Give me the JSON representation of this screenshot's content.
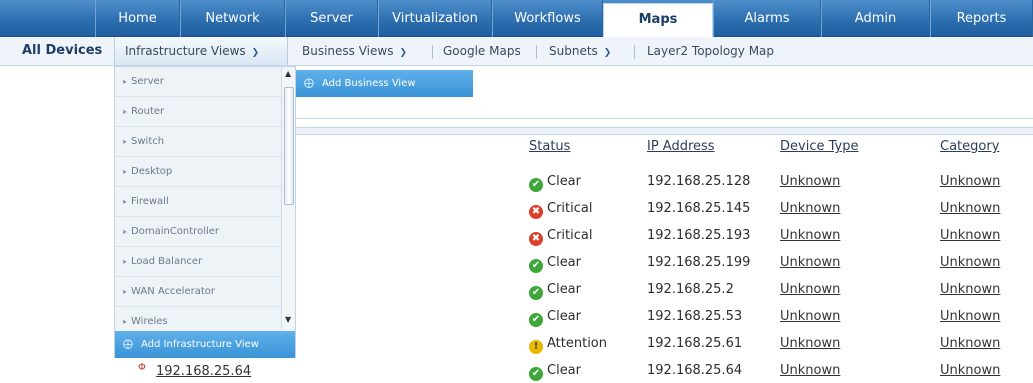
{
  "top_nav": {
    "tabs": [
      {
        "label": "Home"
      },
      {
        "label": "Network"
      },
      {
        "label": "Server"
      },
      {
        "label": "Virtualization"
      },
      {
        "label": "Workflows"
      },
      {
        "label": "Maps"
      },
      {
        "label": "Alarms"
      },
      {
        "label": "Admin"
      },
      {
        "label": "Reports"
      }
    ],
    "active": "Maps"
  },
  "sub_nav": {
    "items": [
      {
        "label": "All Devices"
      },
      {
        "label": "Infrastructure Views"
      },
      {
        "label": "Business Views"
      },
      {
        "label": "Google Maps"
      },
      {
        "label": "Subnets"
      },
      {
        "label": "Layer2 Topology Map"
      }
    ]
  },
  "infrastructure_menu": {
    "items": [
      {
        "label": "Server"
      },
      {
        "label": "Router"
      },
      {
        "label": "Switch"
      },
      {
        "label": "Desktop"
      },
      {
        "label": "Firewall"
      },
      {
        "label": "DomainController"
      },
      {
        "label": "Load Balancer"
      },
      {
        "label": "WAN Accelerator"
      },
      {
        "label": "Wireles"
      }
    ],
    "add_label": "Add Infrastructure View"
  },
  "business_menu": {
    "add_label": "Add Business View"
  },
  "table": {
    "columns": [
      "Status",
      "IP Address",
      "Device Type",
      "Category"
    ],
    "rows": [
      {
        "status": "Clear",
        "status_kind": "clear",
        "ip": "192.168.25.128",
        "device_type": "Unknown",
        "category": "Unknown"
      },
      {
        "status": "Critical",
        "status_kind": "critical",
        "ip": "192.168.25.145",
        "device_type": "Unknown",
        "category": "Unknown"
      },
      {
        "status": "Critical",
        "status_kind": "critical",
        "ip": "192.168.25.193",
        "device_type": "Unknown",
        "category": "Unknown"
      },
      {
        "status": "Clear",
        "status_kind": "clear",
        "ip": "192.168.25.199",
        "device_type": "Unknown",
        "category": "Unknown"
      },
      {
        "status": "Clear",
        "status_kind": "clear",
        "ip": "192.168.25.2",
        "device_type": "Unknown",
        "category": "Unknown"
      },
      {
        "status": "Clear",
        "status_kind": "clear",
        "ip": "192.168.25.53",
        "device_type": "Unknown",
        "category": "Unknown"
      },
      {
        "status": "Attention",
        "status_kind": "attention",
        "ip": "192.168.25.61",
        "device_type": "Unknown",
        "category": "Unknown"
      },
      {
        "status": "Clear",
        "status_kind": "clear",
        "ip": "192.168.25.64",
        "device_type": "Unknown",
        "category": "Unknown"
      }
    ],
    "last_row_name": "192.168.25.64"
  },
  "colors": {
    "clear": "#3fa63a",
    "critical": "#d9402b",
    "attention": "#e8b800",
    "nav_blue": "#2d6fb0",
    "highlight_blue": "#3a93d6"
  },
  "icons": {
    "clear": "check-circle-icon",
    "critical": "x-circle-icon",
    "attention": "exclamation-circle-icon",
    "device": "device-pin-icon"
  }
}
